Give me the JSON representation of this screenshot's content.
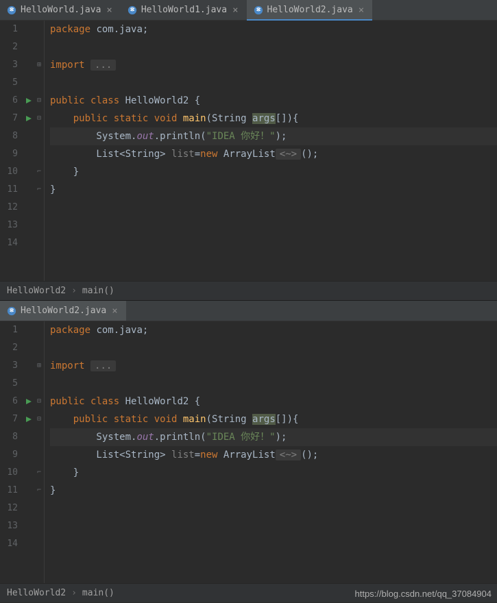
{
  "tabs_top": [
    {
      "name": "HelloWorld.java",
      "close": "×",
      "active": false
    },
    {
      "name": "HelloWorld1.java",
      "close": "×",
      "active": false
    },
    {
      "name": "HelloWorld2.java",
      "close": "×",
      "active": true
    }
  ],
  "tabs_bottom": [
    {
      "name": "HelloWorld2.java",
      "close": "×",
      "active": true
    }
  ],
  "code": {
    "lines": [
      {
        "n": "1",
        "tokens": [
          [
            "kw",
            "package"
          ],
          [
            "",
            " com.java"
          ],
          [
            "",
            ";"
          ]
        ]
      },
      {
        "n": "2",
        "tokens": []
      },
      {
        "n": "3",
        "fold": "⊞",
        "tokens": [
          [
            "kw",
            "import"
          ],
          [
            "",
            " "
          ],
          [
            "box",
            "..."
          ]
        ]
      },
      {
        "n": "5",
        "tokens": []
      },
      {
        "n": "6",
        "run": true,
        "fold": "⊟",
        "tokens": [
          [
            "kw",
            "public class"
          ],
          [
            "",
            " "
          ],
          [
            "cls",
            "HelloWorld2"
          ],
          [
            "",
            " {"
          ]
        ]
      },
      {
        "n": "7",
        "run": true,
        "fold": "⊟",
        "tokens": [
          [
            "",
            "    "
          ],
          [
            "kw",
            "public static void"
          ],
          [
            "",
            " "
          ],
          [
            "mth",
            "main"
          ],
          [
            "",
            "(String "
          ],
          [
            "hlv",
            "args"
          ],
          [
            "",
            "[]){"
          ]
        ]
      },
      {
        "n": "8",
        "hl": true,
        "tokens": [
          [
            "",
            "        System."
          ],
          [
            "fld",
            "out"
          ],
          [
            "",
            ".println("
          ],
          [
            "str",
            "\"IDEA 你好！\""
          ],
          [
            "",
            ");"
          ]
        ]
      },
      {
        "n": "9",
        "tokens": [
          [
            "",
            "        List<String> "
          ],
          [
            "gen",
            "list"
          ],
          [
            "",
            "="
          ],
          [
            "kw",
            "new"
          ],
          [
            "",
            " ArrayList"
          ],
          [
            "box",
            "<~>"
          ],
          [
            "",
            "();"
          ]
        ]
      },
      {
        "n": "10",
        "fold": "⌐",
        "tokens": [
          [
            "",
            "    }"
          ]
        ]
      },
      {
        "n": "11",
        "fold": "⌐",
        "tokens": [
          [
            "",
            "}"
          ]
        ]
      },
      {
        "n": "12",
        "tokens": []
      },
      {
        "n": "13",
        "tokens": []
      },
      {
        "n": "14",
        "tokens": []
      }
    ]
  },
  "breadcrumb": {
    "class": "HelloWorld2",
    "method": "main()"
  },
  "watermark": "https://blog.csdn.net/qq_37084904"
}
